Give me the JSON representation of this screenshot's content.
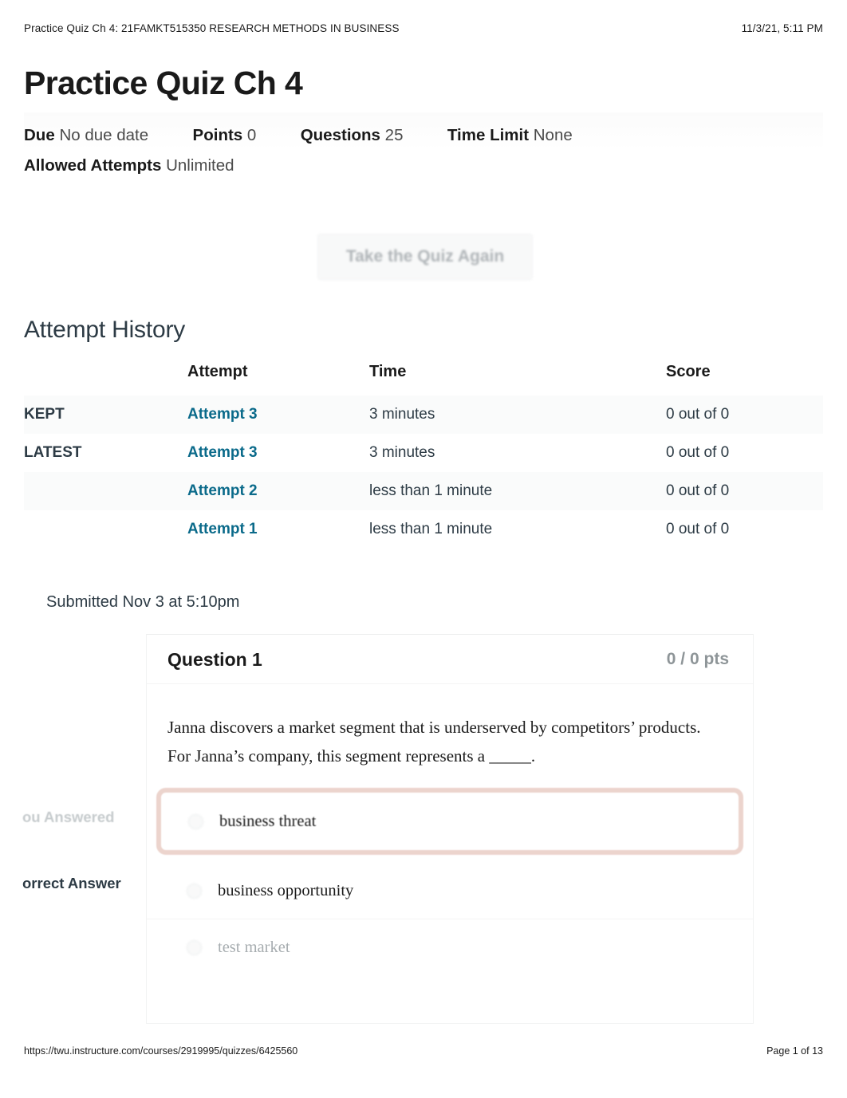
{
  "print_header": {
    "document_title": "Practice Quiz Ch 4: 21FAMKT515350 RESEARCH METHODS IN BUSINESS",
    "timestamp": "11/3/21, 5:11 PM"
  },
  "print_footer": {
    "url": "https://twu.instructure.com/courses/2919995/quizzes/6425560",
    "page_indicator": "Page 1 of 13"
  },
  "quiz": {
    "title": "Practice Quiz Ch 4",
    "meta": {
      "due_label": "Due",
      "due_value": "No due date",
      "points_label": "Points",
      "points_value": "0",
      "questions_label": "Questions",
      "questions_value": "25",
      "time_limit_label": "Time Limit",
      "time_limit_value": "None",
      "allowed_attempts_label": "Allowed Attempts",
      "allowed_attempts_value": "Unlimited"
    },
    "take_again_button": "Take the Quiz Again"
  },
  "attempt_history": {
    "heading": "Attempt History",
    "columns": [
      "",
      "Attempt",
      "Time",
      "Score"
    ],
    "rows": [
      {
        "flag": "KEPT",
        "attempt": "Attempt 3",
        "time": "3 minutes",
        "score": "0 out of 0"
      },
      {
        "flag": "LATEST",
        "attempt": "Attempt 3",
        "time": "3 minutes",
        "score": "0 out of 0"
      },
      {
        "flag": "",
        "attempt": "Attempt 2",
        "time": "less than 1 minute",
        "score": "0 out of 0"
      },
      {
        "flag": "",
        "attempt": "Attempt 1",
        "time": "less than 1 minute",
        "score": "0 out of 0"
      }
    ]
  },
  "submitted_line": "Submitted Nov 3 at 5:10pm",
  "question": {
    "number_label": "Question 1",
    "points_label": "0 / 0 pts",
    "text": "Janna discovers a market segment that is underserved by competitors’ products. For Janna’s company, this segment represents a _____.",
    "labels": {
      "you_answered": "ou Answered",
      "correct_answer": "orrect Answer"
    },
    "options": [
      {
        "text": "business threat",
        "state": "selected-incorrect"
      },
      {
        "text": "business opportunity",
        "state": "correct"
      },
      {
        "text": "test market",
        "state": "dim"
      }
    ]
  },
  "colors": {
    "link": "#0a6a8a",
    "incorrect_outline": "#ecd4cd",
    "muted_text": "#8e9598",
    "body_text": "#2d3b45"
  }
}
